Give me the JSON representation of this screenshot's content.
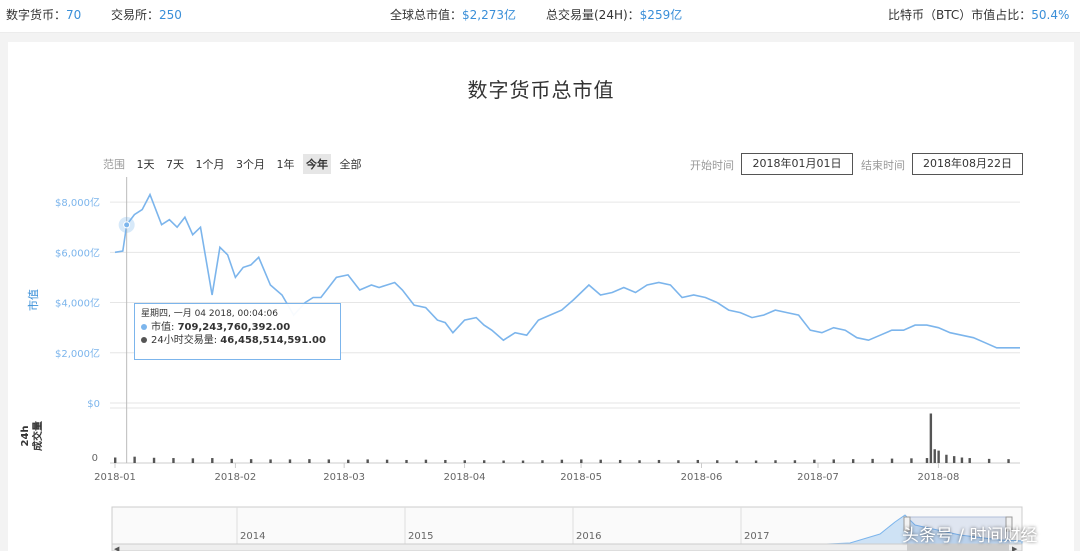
{
  "topbar": {
    "coins_label": "数字货币：",
    "coins_value": "70",
    "exchanges_label": "交易所：",
    "exchanges_value": "250",
    "market_cap_label": "全球总市值：",
    "market_cap_value": "$2,273亿",
    "volume_label": "总交易量(24H)：",
    "volume_value": "$259亿",
    "btc_share_label": "比特币（BTC）市值占比：",
    "btc_share_value": "50.4%"
  },
  "colors": {
    "accent": "#3a8fd8",
    "line": "#7cb5ec",
    "volume": "#555555"
  },
  "range_selector": {
    "label": "范围",
    "options": [
      "1天",
      "7天",
      "1个月",
      "3个月",
      "1年",
      "今年",
      "全部"
    ],
    "active": "今年"
  },
  "date_range": {
    "start_label": "开始时间",
    "start_value": "2018年01月01日",
    "end_label": "结束时间",
    "end_value": "2018年08月22日"
  },
  "tooltip": {
    "date": "星期四, 一月 04 2018, 00:04:06",
    "cap_label": "市值: ",
    "cap_value": "709,243,760,392.00",
    "vol_label": "24小时交易量: ",
    "vol_value": "46,458,514,591.00"
  },
  "navigator": {
    "years": [
      "2014",
      "2015",
      "2016",
      "2017"
    ]
  },
  "watermark": "头条号 / 时间财经",
  "chart_data": {
    "type": "line",
    "title": "数字货币总市值",
    "ylabel": "市值",
    "volume_ylabel": "24h成交量",
    "y_ticks": [
      "$0",
      "$2,000亿",
      "$4,000亿",
      "$6,000亿",
      "$8,000亿"
    ],
    "ylim": [
      0,
      8000
    ],
    "volume_y_ticks": [
      "0"
    ],
    "x_ticks": [
      "2018-01",
      "2018-02",
      "2018-03",
      "2018-04",
      "2018-05",
      "2018-06",
      "2018-07",
      "2018-08"
    ],
    "xlim_days": [
      0,
      233
    ],
    "grid": true,
    "series": [
      {
        "name": "市值",
        "unit": "亿美元",
        "x_days": [
          0,
          2,
          3,
          5,
          7,
          9,
          12,
          14,
          16,
          18,
          20,
          22,
          25,
          27,
          29,
          31,
          33,
          35,
          37,
          40,
          43,
          46,
          49,
          51,
          53,
          55,
          57,
          60,
          63,
          66,
          68,
          70,
          72,
          74,
          77,
          80,
          83,
          85,
          87,
          90,
          93,
          95,
          97,
          100,
          103,
          106,
          109,
          112,
          115,
          118,
          120,
          122,
          125,
          128,
          131,
          134,
          137,
          140,
          143,
          146,
          149,
          152,
          155,
          158,
          161,
          164,
          167,
          170,
          173,
          176,
          179,
          182,
          185,
          188,
          191,
          194,
          197,
          200,
          203,
          206,
          209,
          212,
          215,
          218,
          221,
          224,
          227,
          230,
          233
        ],
        "values": [
          6000,
          6050,
          7092,
          7500,
          7700,
          8300,
          7100,
          7300,
          7000,
          7400,
          6700,
          7000,
          4300,
          6200,
          5900,
          5000,
          5400,
          5500,
          5800,
          4700,
          4300,
          3500,
          4000,
          4200,
          4200,
          4600,
          5000,
          5100,
          4500,
          4700,
          4600,
          4700,
          4800,
          4500,
          3900,
          3800,
          3300,
          3200,
          2800,
          3300,
          3400,
          3100,
          2900,
          2500,
          2800,
          2700,
          3300,
          3500,
          3700,
          4100,
          4400,
          4700,
          4300,
          4400,
          4600,
          4400,
          4700,
          4800,
          4700,
          4200,
          4300,
          4200,
          4000,
          3700,
          3600,
          3400,
          3500,
          3700,
          3600,
          3500,
          2900,
          2800,
          3000,
          2900,
          2600,
          2500,
          2700,
          2900,
          2900,
          3100,
          3100,
          3000,
          2800,
          2700,
          2600,
          2400,
          2200,
          2200,
          2200
        ]
      },
      {
        "name": "24小时交易量",
        "unit": "亿美元",
        "x_days": [
          0,
          5,
          10,
          15,
          20,
          25,
          30,
          35,
          40,
          45,
          50,
          55,
          60,
          65,
          70,
          75,
          80,
          85,
          90,
          95,
          100,
          105,
          110,
          115,
          120,
          125,
          130,
          135,
          140,
          145,
          150,
          155,
          160,
          165,
          170,
          175,
          180,
          185,
          190,
          195,
          200,
          205,
          209,
          210,
          211,
          212,
          214,
          216,
          218,
          220,
          225,
          230
        ],
        "values": [
          200,
          230,
          190,
          180,
          170,
          180,
          150,
          140,
          130,
          130,
          140,
          130,
          120,
          130,
          120,
          110,
          120,
          110,
          100,
          100,
          90,
          90,
          100,
          120,
          130,
          120,
          110,
          100,
          110,
          100,
          110,
          100,
          90,
          90,
          100,
          100,
          120,
          130,
          140,
          150,
          160,
          170,
          180,
          1800,
          500,
          450,
          300,
          250,
          200,
          180,
          150,
          140
        ]
      }
    ]
  }
}
